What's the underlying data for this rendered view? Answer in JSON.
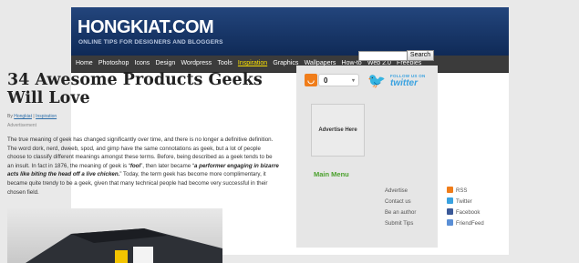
{
  "header": {
    "logo": "HONGKIAT.COM",
    "tagline": "ONLINE TIPS FOR DESIGNERS AND BLOGGERS"
  },
  "nav": {
    "items": [
      "Home",
      "Photoshop",
      "Icons",
      "Design",
      "Wordpress",
      "Tools",
      "Inspiration",
      "Graphics",
      "Wallpapers",
      "How-to",
      "Web 2.0",
      "Freebies"
    ],
    "active": "Inspiration"
  },
  "search": {
    "placeholder": "",
    "button_label": "Search"
  },
  "article": {
    "title": "34 Awesome Products Geeks Will Love",
    "byline_prefix": "By",
    "author": "Hongkiat",
    "separator": "|",
    "category": "Inspiration",
    "ad_label": "Advertisement",
    "p1": "The true meaning of geek has changed significantly over time, and there is no longer a definitive definition. The word dork, nerd, dweeb, spod, and gimp have the same connotations as geek, but a lot of people choose to classify different meanings amongst these terms. Before, being described as a geek tends to be an insult. In fact in 1876, the meaning of geek is “",
    "em1": "fool",
    "p2": "”, then later became “",
    "em2": "a performer engaging in bizarre acts like biting the head off a live chicken.",
    "p3": "” Today, the term geek has become more complimentary, it became quite trendy to be a geek, given that many technical people had become very successful in their chosen field."
  },
  "sidebar": {
    "rss_count": "0",
    "twitter_follow": "FOLLOW US ON",
    "twitter_name": "twitter",
    "ad_text": "Advertise Here",
    "menu_title": "Main Menu",
    "left_menu": [
      "Advertise",
      "Contact us",
      "Be an author",
      "Submit Tips"
    ],
    "right_menu": [
      "RSS",
      "Twitter",
      "Facebook",
      "FriendFeed"
    ]
  },
  "colors": {
    "header_bg": "#1b3a6b",
    "nav_bg": "#3b3b3b",
    "nav_active": "#ffe400",
    "menu_title": "#4aa02c",
    "rss": "#f07d1a",
    "twitter": "#3aa2e0"
  }
}
